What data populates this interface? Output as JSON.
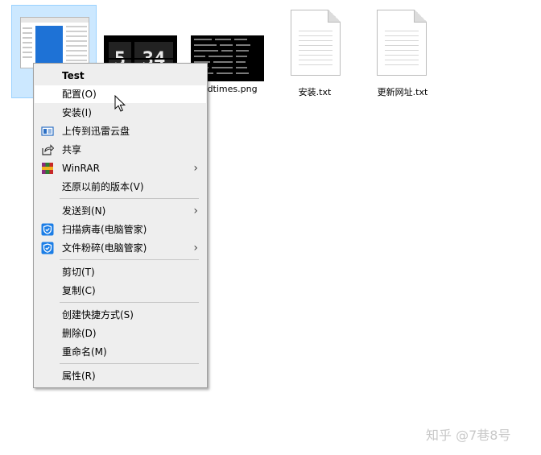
{
  "desktop": {
    "files": [
      {
        "name": "",
        "selected": true
      },
      {
        "name": "",
        "thumb_digits": [
          "5",
          "34"
        ]
      },
      {
        "name": "rldtimes.png"
      },
      {
        "name": "安装.txt"
      },
      {
        "name": "更新网址.txt"
      }
    ]
  },
  "context_menu": {
    "items": [
      {
        "label": "Test"
      },
      {
        "label": "配置(O)"
      },
      {
        "label": "安装(I)"
      },
      {
        "label": "上传到迅雷云盘",
        "icon": "thunder-cloud-icon"
      },
      {
        "label": "共享",
        "icon": "share-icon"
      },
      {
        "label": "WinRAR",
        "icon": "winrar-icon"
      },
      {
        "label": "还原以前的版本(V)"
      },
      {
        "label": "发送到(N)"
      },
      {
        "label": "扫描病毒(电脑管家)",
        "icon": "pc-manager-shield-icon"
      },
      {
        "label": "文件粉碎(电脑管家)",
        "icon": "pc-manager-shield-icon"
      },
      {
        "label": "剪切(T)"
      },
      {
        "label": "复制(C)"
      },
      {
        "label": "创建快捷方式(S)"
      },
      {
        "label": "删除(D)"
      },
      {
        "label": "重命名(M)"
      },
      {
        "label": "属性(R)"
      }
    ],
    "submenu_arrow": "›"
  },
  "watermark": {
    "text": "知乎 @7巷8号"
  },
  "colors": {
    "selection": "#cce8ff",
    "menu_bg": "#eeeeee",
    "menu_highlight": "#ffffff",
    "shield_blue": "#1c7ee6"
  }
}
